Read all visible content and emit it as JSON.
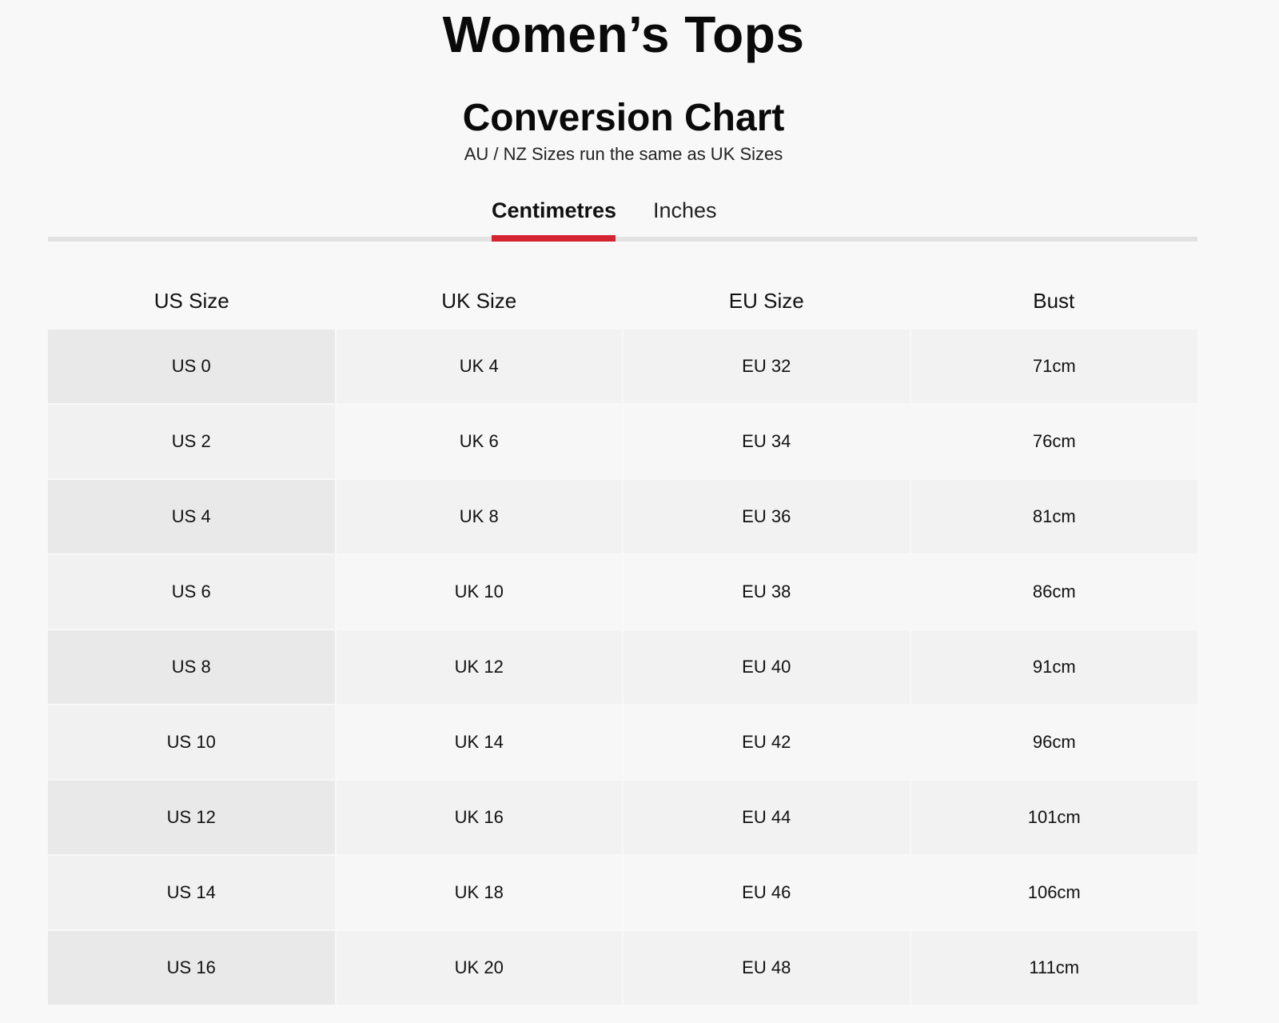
{
  "page": {
    "title": "Women’s Tops"
  },
  "chart": {
    "title": "Conversion Chart",
    "subtitle": "AU / NZ Sizes run the same as UK Sizes"
  },
  "tabs": [
    {
      "label": "Centimetres",
      "active": true
    },
    {
      "label": "Inches",
      "active": false
    }
  ],
  "colors": {
    "accent": "#d62331",
    "background": "#f8f8f8"
  },
  "table": {
    "headers": [
      "US Size",
      "UK Size",
      "EU Size",
      "Bust"
    ],
    "rows": [
      [
        "US 0",
        "UK 4",
        "EU 32",
        "71cm"
      ],
      [
        "US 2",
        "UK 6",
        "EU 34",
        "76cm"
      ],
      [
        "US 4",
        "UK 8",
        "EU 36",
        "81cm"
      ],
      [
        "US 6",
        "UK 10",
        "EU 38",
        "86cm"
      ],
      [
        "US 8",
        "UK 12",
        "EU 40",
        "91cm"
      ],
      [
        "US 10",
        "UK 14",
        "EU 42",
        "96cm"
      ],
      [
        "US 12",
        "UK 16",
        "EU 44",
        "101cm"
      ],
      [
        "US 14",
        "UK 18",
        "EU 46",
        "106cm"
      ],
      [
        "US 16",
        "UK 20",
        "EU 48",
        "111cm"
      ]
    ]
  }
}
